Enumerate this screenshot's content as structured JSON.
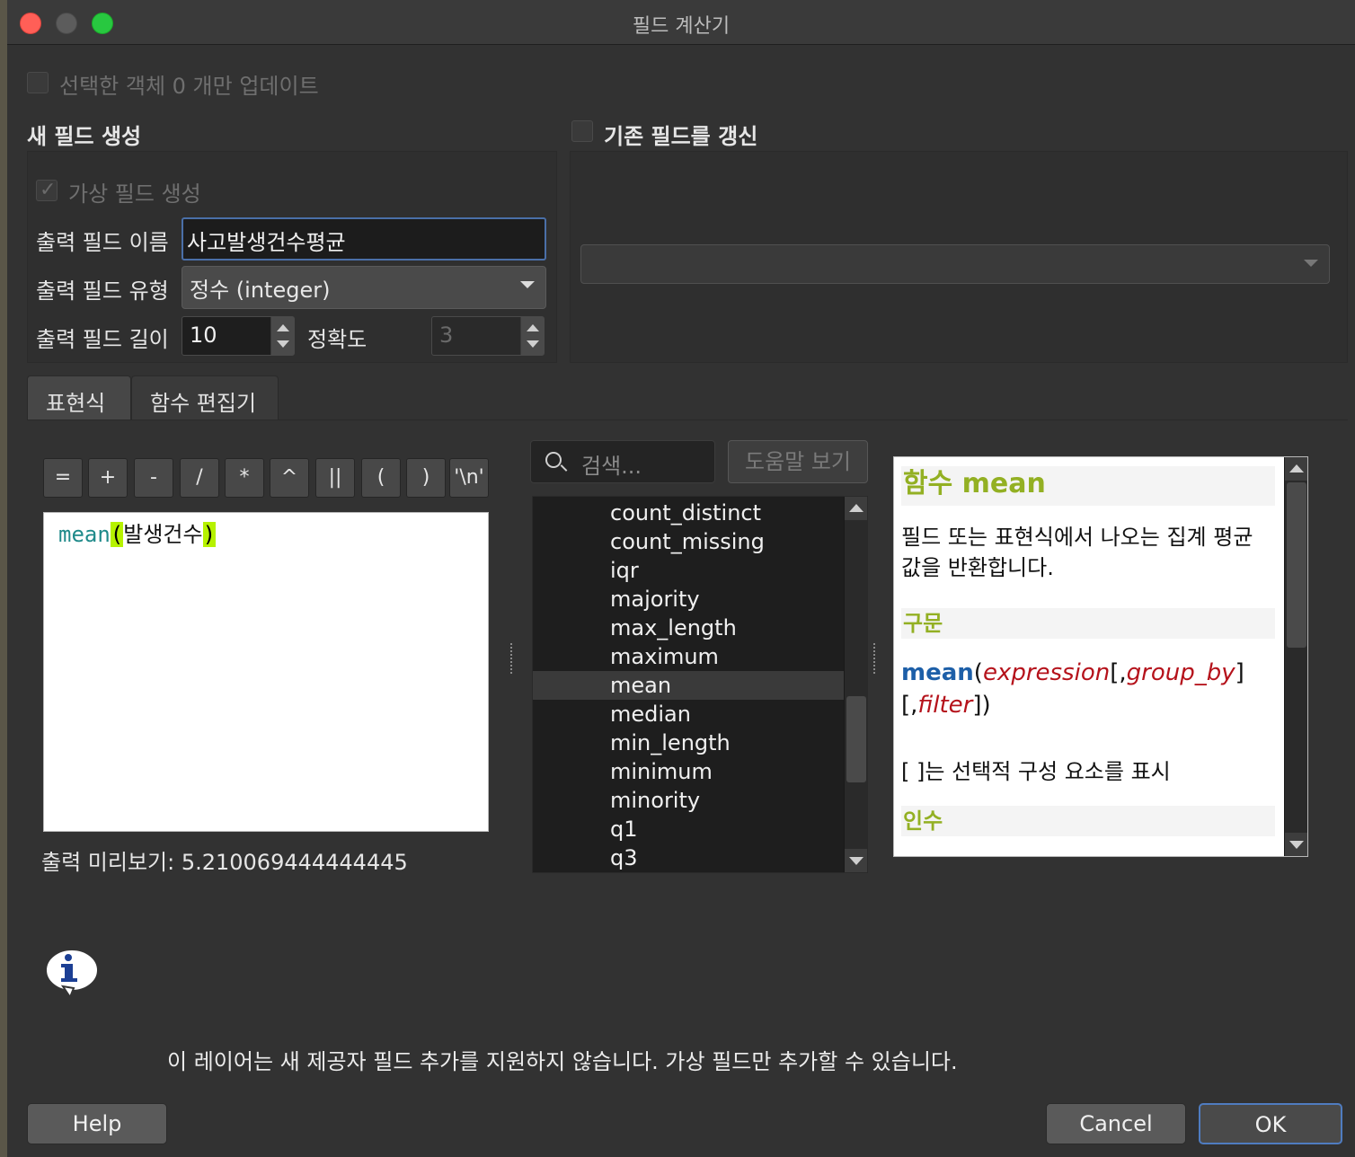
{
  "window": {
    "title": "필드 계산기"
  },
  "update_selected": {
    "label": "선택한 객체 0 개만 업데이트",
    "checked": false
  },
  "new_field": {
    "section_label": "새 필드 생성",
    "virtual_field_label": "가상 필드 생성",
    "virtual_field_checked": true,
    "output_name_label": "출력 필드 이름",
    "output_name_value": "사고발생건수평균",
    "output_type_label": "출력 필드 유형",
    "output_type_value": "정수 (integer)",
    "output_length_label": "출력 필드 길이",
    "output_length_value": "10",
    "precision_label": "정확도",
    "precision_value": "3"
  },
  "update_existing": {
    "label": "기존 필드를 갱신",
    "checked": false,
    "combo_value": ""
  },
  "tabs": [
    {
      "label": "표현식"
    },
    {
      "label": "함수 편집기"
    }
  ],
  "operators": [
    "=",
    "+",
    "-",
    "/",
    "*",
    "^",
    "||",
    "(",
    ")",
    "'\\n'"
  ],
  "expression": {
    "function": "mean",
    "open": "(",
    "argument": "발생건수",
    "close": ")"
  },
  "preview": "출력 미리보기: 5.210069444444445",
  "search": {
    "placeholder": "검색..."
  },
  "help_view_button": "도움말 보기",
  "function_list": [
    "count_distinct",
    "count_missing",
    "iqr",
    "majority",
    "max_length",
    "maximum",
    "mean",
    "median",
    "min_length",
    "minimum",
    "minority",
    "q1",
    "q3"
  ],
  "selected_function": "mean",
  "help": {
    "title": "함수 mean",
    "description": "필드 또는 표현식에서 나오는 집계 평균 값을 반환합니다.",
    "syntax_header": "구문",
    "syntax_fn": "mean",
    "syntax_arg1": "expression",
    "syntax_arg2": "group_by",
    "syntax_arg3": "filter",
    "optional_note": "[ ]는 선택적 구성 요소를 표시",
    "arguments_header": "인수"
  },
  "message": "이 레이어는 새 제공자 필드 추가를 지원하지 않습니다. 가상 필드만 추가할 수 있습니다.",
  "buttons": {
    "help": "Help",
    "cancel": "Cancel",
    "ok": "OK"
  },
  "colors": {
    "accent_green": "#93b023",
    "function_blue": "#1d5fa8",
    "arg_red": "#b5121b",
    "paren_highlight": "#b6f200",
    "focus_blue": "#4f7cc0"
  }
}
